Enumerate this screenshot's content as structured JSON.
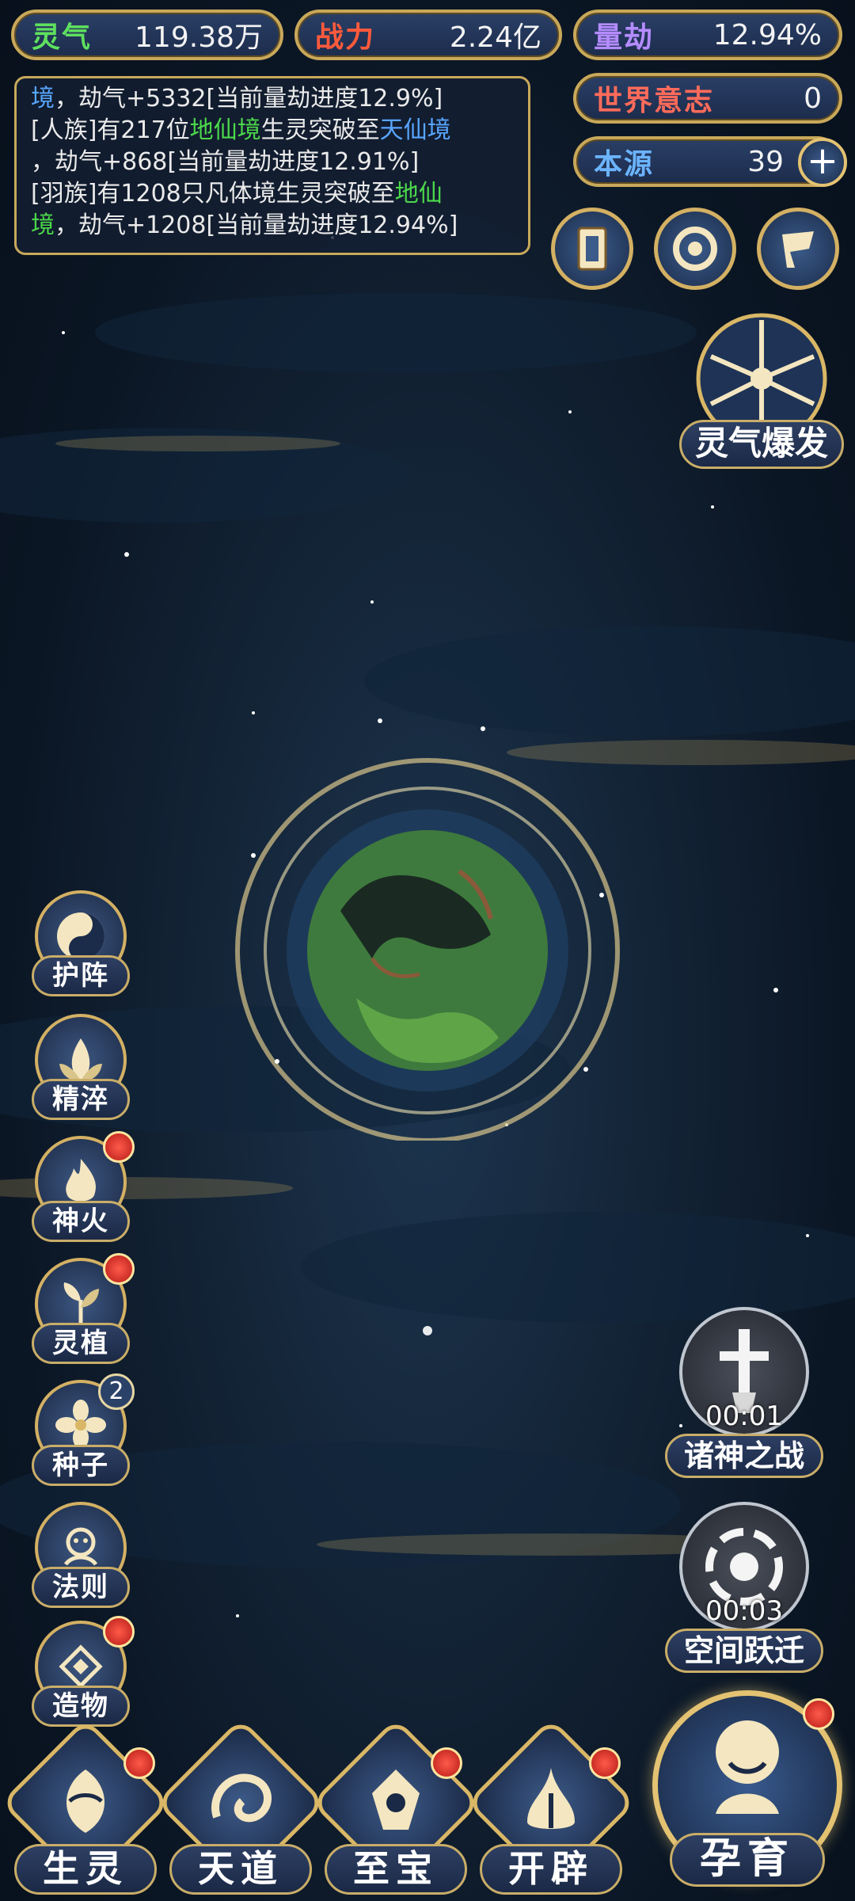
{
  "stats": {
    "lingqi": {
      "label": "灵气",
      "value": "119.38万",
      "color": "#5ee05e"
    },
    "zhanli": {
      "label": "战力",
      "value": "2.24亿",
      "color": "#ff5a3c"
    },
    "liangjie": {
      "label": "量劫",
      "value": "12.94%",
      "color": "#b48cff"
    },
    "shijie_yizhi": {
      "label": "世界意志",
      "value": "0",
      "color": "#ff6b5a"
    },
    "benyuan": {
      "label": "本源",
      "value": "39",
      "color": "#6cb4ff"
    }
  },
  "log": {
    "line1_a": "境",
    "line1_b": "，劫气+5332[当前量劫进度12.9%]",
    "line2_a": "[人族]有217位",
    "line2_b": "地仙境",
    "line2_c": "生灵突破至",
    "line2_d": "天仙境",
    "line3": "，劫气+868[当前量劫进度12.91%]",
    "line4_a": "[羽族]有1208只凡体境生灵突破至",
    "line4_b": "地仙",
    "line5_a": "境",
    "line5_b": "，劫气+1208[当前量劫进度12.94%]"
  },
  "top_buttons": {
    "card_icon": "card-icon",
    "portal_icon": "portal-icon",
    "flag_icon": "flag-icon"
  },
  "burst": {
    "label": "灵气爆发",
    "icon": "starburst-icon"
  },
  "left_menu": [
    {
      "label": "护阵",
      "icon": "taiji-icon",
      "dot": false
    },
    {
      "label": "精淬",
      "icon": "lotus-icon",
      "dot": false
    },
    {
      "label": "神火",
      "icon": "flame-icon",
      "dot": true
    },
    {
      "label": "灵植",
      "icon": "plant-icon",
      "dot": true
    },
    {
      "label": "种子",
      "icon": "flower-icon",
      "badge": "2"
    },
    {
      "label": "法则",
      "icon": "rule-icon",
      "dot": false
    },
    {
      "label": "造物",
      "icon": "creation-icon",
      "dot": true
    }
  ],
  "right_events": [
    {
      "label": "诸神之战",
      "timer": "00:01",
      "icon": "sword-icon"
    },
    {
      "label": "空间跃迁",
      "timer": "00:03",
      "icon": "vortex-icon"
    }
  ],
  "bottom_nav": [
    {
      "label": "生灵",
      "icon": "creature-icon"
    },
    {
      "label": "天道",
      "icon": "heaven-icon"
    },
    {
      "label": "至宝",
      "icon": "treasure-icon"
    },
    {
      "label": "开辟",
      "icon": "open-icon"
    }
  ],
  "yunyu": {
    "label": "孕育",
    "icon": "figure-icon"
  }
}
